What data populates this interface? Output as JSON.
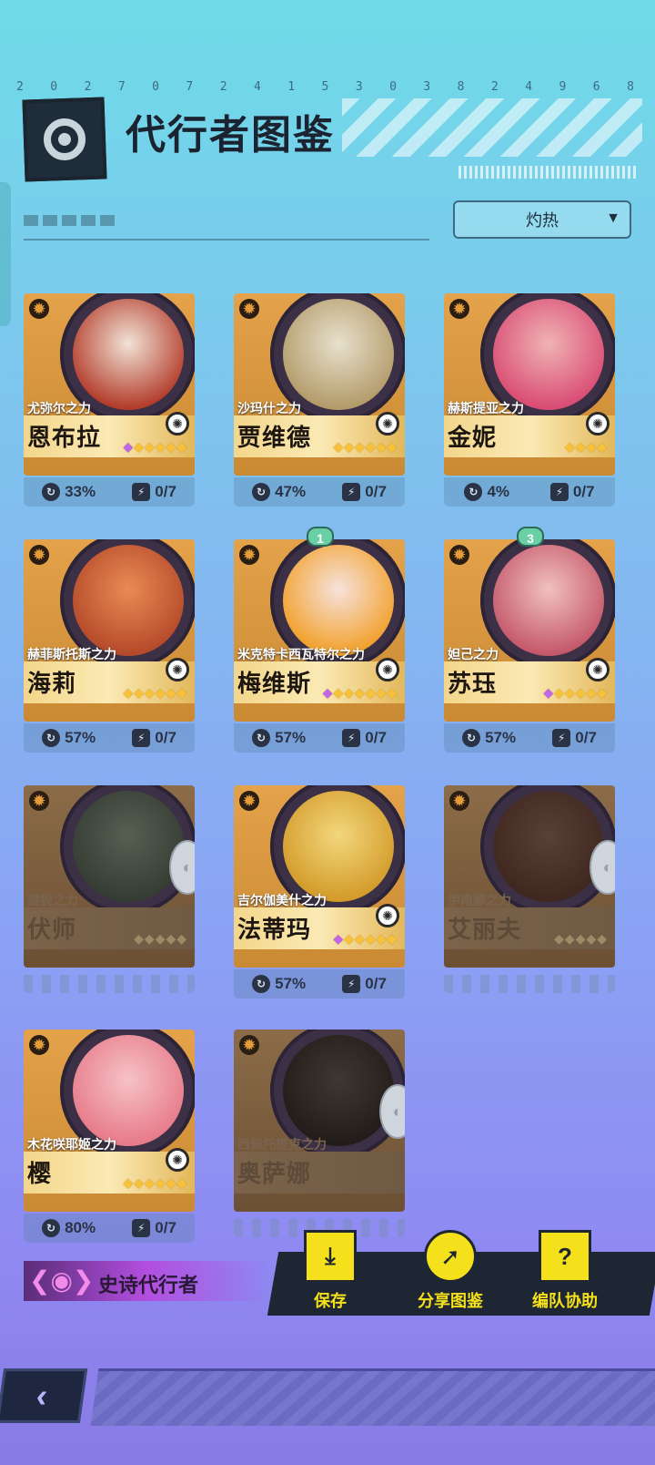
{
  "header": {
    "digits": [
      "2",
      "0",
      "2",
      "7",
      "0",
      "7",
      "2",
      "4",
      "1",
      "5",
      "3",
      "0",
      "3",
      "8",
      "2",
      "4",
      "9",
      "6",
      "8"
    ],
    "title": "代行者图鉴"
  },
  "filter": {
    "sort_value": "灼热"
  },
  "colors": {
    "card_gold": "#e4a24a",
    "card_locked": "#8c6c48",
    "accent_yellow": "#f5e11b",
    "epic_purple": "#b34ee0"
  },
  "cards": [
    {
      "subtitle": "尤弥尔之力",
      "name": "恩布拉",
      "progress": "33%",
      "count": "0/7",
      "locked": false,
      "stars": 5,
      "gem": true,
      "rank": ""
    },
    {
      "subtitle": "沙玛什之力",
      "name": "贾维德",
      "progress": "47%",
      "count": "0/7",
      "locked": false,
      "stars": 6,
      "gem": false,
      "rank": ""
    },
    {
      "subtitle": "赫斯提亚之力",
      "name": "金妮",
      "progress": "4%",
      "count": "0/7",
      "locked": false,
      "stars": 4,
      "gem": false,
      "rank": ""
    },
    {
      "subtitle": "赫菲斯托斯之力",
      "name": "海莉",
      "progress": "57%",
      "count": "0/7",
      "locked": false,
      "stars": 6,
      "gem": false,
      "rank": ""
    },
    {
      "subtitle": "米克特卡西瓦特尔之力",
      "name": "梅维斯",
      "progress": "57%",
      "count": "0/7",
      "locked": false,
      "stars": 6,
      "gem": true,
      "rank": "1"
    },
    {
      "subtitle": "妲己之力",
      "name": "苏珏",
      "progress": "57%",
      "count": "0/7",
      "locked": false,
      "stars": 5,
      "gem": true,
      "rank": "3"
    },
    {
      "subtitle": "狻猊之力",
      "name": "伏师",
      "progress": "",
      "count": "",
      "locked": true,
      "stars": 5,
      "gem": false,
      "rank": ""
    },
    {
      "subtitle": "吉尔伽美什之力",
      "name": "法蒂玛",
      "progress": "57%",
      "count": "0/7",
      "locked": false,
      "stars": 5,
      "gem": true,
      "rank": ""
    },
    {
      "subtitle": "伊南娜之力",
      "name": "艾丽夫",
      "progress": "",
      "count": "",
      "locked": true,
      "stars": 5,
      "gem": false,
      "rank": ""
    },
    {
      "subtitle": "木花咲耶姬之力",
      "name": "樱",
      "progress": "80%",
      "count": "0/7",
      "locked": false,
      "stars": 6,
      "gem": false,
      "rank": ""
    },
    {
      "subtitle": "西佩托提克之力",
      "name": "奥萨娜",
      "progress": "",
      "count": "",
      "locked": true,
      "stars": 0,
      "gem": false,
      "rank": ""
    }
  ],
  "bottom": {
    "epic_label": "史诗代行者",
    "actions": [
      {
        "label": "保存",
        "icon": "folder-download-icon"
      },
      {
        "label": "分享图鉴",
        "icon": "share-disc-icon"
      },
      {
        "label": "编队协助",
        "icon": "question-cards-icon"
      }
    ]
  }
}
